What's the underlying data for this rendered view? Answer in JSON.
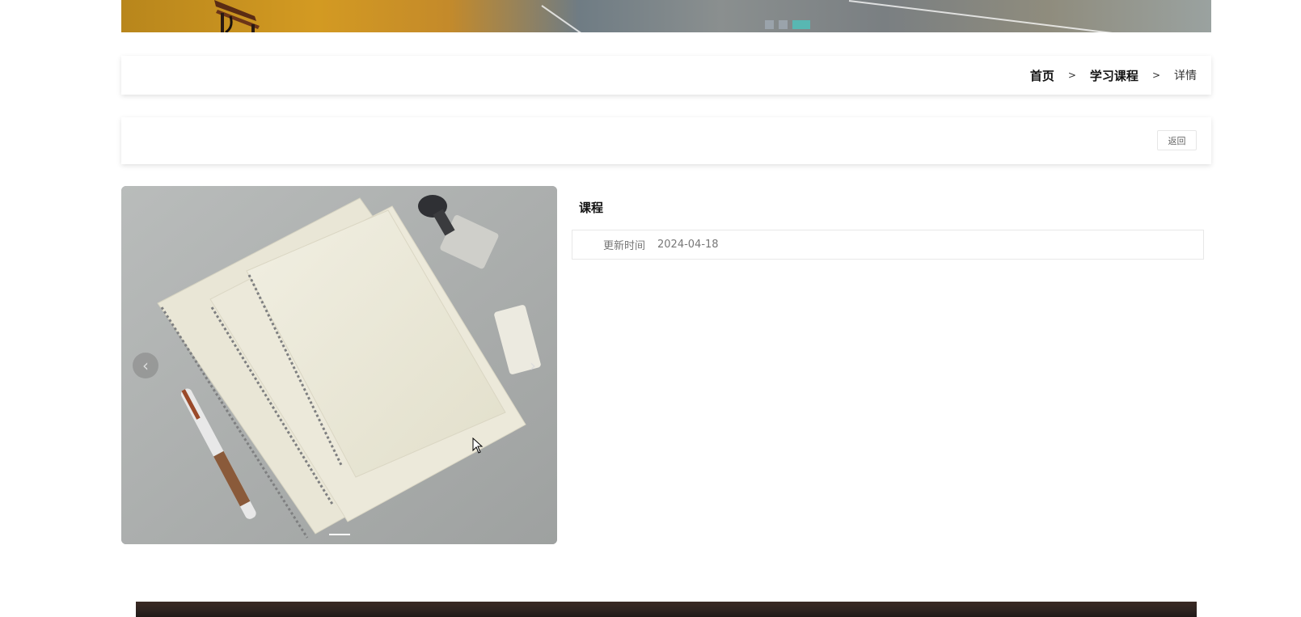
{
  "banner": {
    "slide_count": 3,
    "active_slide": 3
  },
  "breadcrumb": {
    "home": "首页",
    "separator": ">",
    "category": "学习课程",
    "current": "详情"
  },
  "actions": {
    "back_label": "返回"
  },
  "carousel": {
    "prev_glyph": "‹",
    "next_glyph": "›"
  },
  "course": {
    "title": "课程",
    "updated_label": "更新时间",
    "updated_value": "2024-04-18"
  },
  "colors": {
    "accent": "#58b7b2",
    "dot_inactive": "#9aa3ab"
  }
}
